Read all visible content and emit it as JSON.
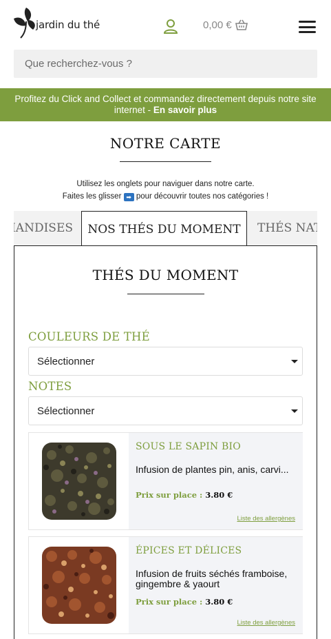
{
  "header": {
    "logo_text": "jardin du thé",
    "cart_total": "0,00 €"
  },
  "search": {
    "placeholder": "Que recherchez-vous ?"
  },
  "banner": {
    "text": "Profitez du Click and Collect et commandez directement depuis notre site internet - ",
    "link": "En savoir plus"
  },
  "main": {
    "title": "NOTRE CARTE",
    "intro_line1": "Utilisez les onglets pour naviguer dans notre carte.",
    "intro_line2_before": "Faites les glisser",
    "intro_arrow": "➡",
    "intro_line2_after": "pour découvrir toutes nos catégories !"
  },
  "tabs": [
    {
      "label": "FRIANDISES"
    },
    {
      "label": "NOS THÉS DU MOMENT",
      "active": true
    },
    {
      "label": "THÉS NATURE"
    }
  ],
  "panel": {
    "title": "THÉS DU MOMENT",
    "filters": [
      {
        "label": "COULEURS DE THÉ",
        "selected": "Sélectionner"
      },
      {
        "label": "NOTES",
        "selected": "Sélectionner"
      }
    ],
    "products": [
      {
        "name": "SOUS LE SAPIN BIO",
        "description": "Infusion de plantes pin, anis, carvi...",
        "price_label": "Prix sur place :",
        "price": "3.80 €",
        "allergens_link": "Liste des allergènes",
        "image": "dried-herbal-tea-leaves"
      },
      {
        "name": "ÉPICES ET DÉLICES",
        "description": "Infusion de fruits séchés framboise, gingembre & yaourt",
        "price_label": "Prix sur place :",
        "price": "3.80 €",
        "allergens_link": "Liste des allergènes",
        "image": "dried-fruit-infusion"
      }
    ]
  },
  "colors": {
    "accent_green": "#7e9e3e",
    "arrow_blue": "#2d73c0"
  }
}
